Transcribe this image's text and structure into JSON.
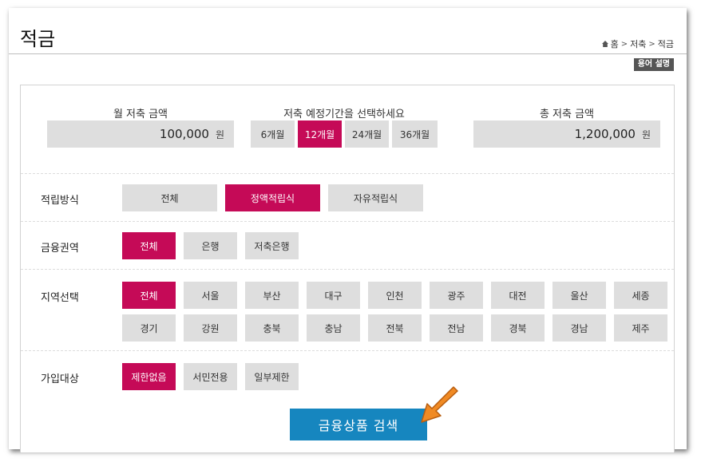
{
  "header": {
    "title": "적금",
    "breadcrumb": [
      "홈",
      "저축",
      "적금"
    ],
    "help_label": "용어 설명"
  },
  "amounts": {
    "monthly_label": "월 저축 금액",
    "monthly_value": "100,000",
    "period_label": "저축 예정기간을 선택하세요",
    "total_label": "총 저축 금액",
    "total_value": "1,200,000",
    "unit": "원"
  },
  "periods": [
    {
      "label": "6개월",
      "selected": false
    },
    {
      "label": "12개월",
      "selected": true
    },
    {
      "label": "24개월",
      "selected": false
    },
    {
      "label": "36개월",
      "selected": false
    }
  ],
  "filters": {
    "method": {
      "label": "적립방식",
      "options": [
        {
          "label": "전체",
          "selected": false
        },
        {
          "label": "정액적립식",
          "selected": true
        },
        {
          "label": "자유적립식",
          "selected": false
        }
      ]
    },
    "sector": {
      "label": "금융권역",
      "options": [
        {
          "label": "전체",
          "selected": true
        },
        {
          "label": "은행",
          "selected": false
        },
        {
          "label": "저축은행",
          "selected": false
        }
      ]
    },
    "region": {
      "label": "지역선택",
      "options": [
        {
          "label": "전체",
          "selected": true
        },
        {
          "label": "서울",
          "selected": false
        },
        {
          "label": "부산",
          "selected": false
        },
        {
          "label": "대구",
          "selected": false
        },
        {
          "label": "인천",
          "selected": false
        },
        {
          "label": "광주",
          "selected": false
        },
        {
          "label": "대전",
          "selected": false
        },
        {
          "label": "울산",
          "selected": false
        },
        {
          "label": "세종",
          "selected": false
        },
        {
          "label": "경기",
          "selected": false
        },
        {
          "label": "강원",
          "selected": false
        },
        {
          "label": "충북",
          "selected": false
        },
        {
          "label": "충남",
          "selected": false
        },
        {
          "label": "전북",
          "selected": false
        },
        {
          "label": "전남",
          "selected": false
        },
        {
          "label": "경북",
          "selected": false
        },
        {
          "label": "경남",
          "selected": false
        },
        {
          "label": "제주",
          "selected": false
        }
      ]
    },
    "eligibility": {
      "label": "가입대상",
      "options": [
        {
          "label": "제한없음",
          "selected": true
        },
        {
          "label": "서민전용",
          "selected": false
        },
        {
          "label": "일부제한",
          "selected": false
        }
      ]
    }
  },
  "search_label": "금융상품 검색",
  "colors": {
    "accent": "#c50a57",
    "button": "#1686bf",
    "arrow": "#f08a24"
  }
}
